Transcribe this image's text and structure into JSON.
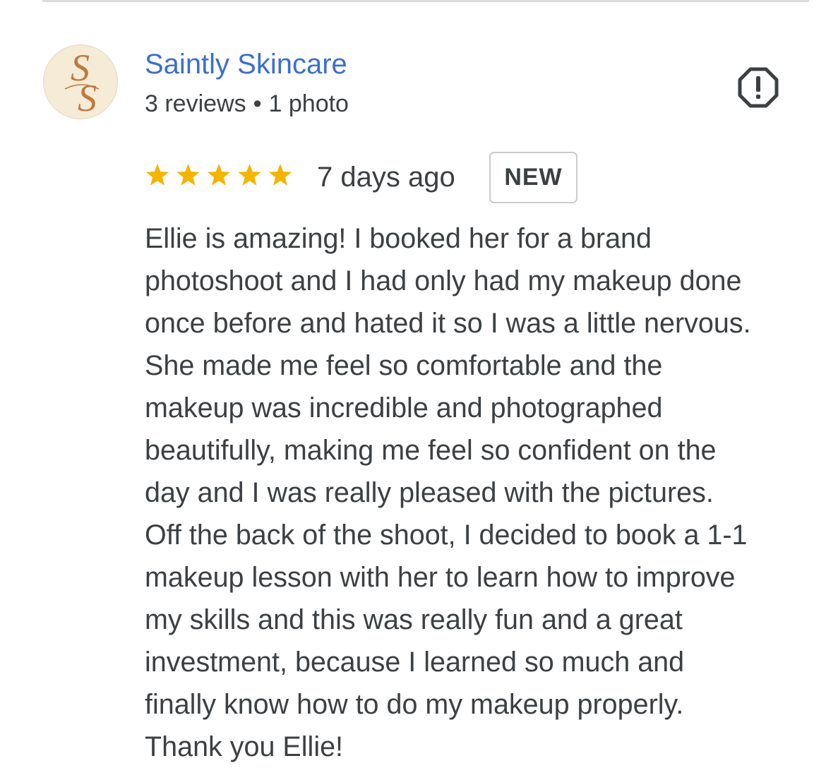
{
  "author": {
    "name": "Saintly Skincare",
    "avatar_monogram": "SS",
    "reviews_count": "3 reviews",
    "separator": "•",
    "photos_count": "1 photo"
  },
  "report_icon": "flag-alert-icon",
  "review": {
    "rating": 5,
    "rating_max": 5,
    "star_color": "#f4b400",
    "date": "7 days ago",
    "badge": "NEW",
    "text_lines": [
      "Ellie is amazing! I booked her for a brand",
      "photoshoot and I had only had my makeup done",
      "once before and hated it so I was a little nervous.",
      "She made me feel so comfortable and the",
      "makeup was incredible and photographed",
      "beautifully, making me feel so confident on the",
      "day and I was really pleased with the pictures.",
      "Off the back of the shoot, I decided to book a 1-1",
      "makeup lesson with her to learn how to improve",
      "my skills and this was really fun and a great",
      "investment, because I learned so much and",
      "finally know how to do my makeup properly.",
      "Thank you Ellie!"
    ]
  },
  "colors": {
    "author_link": "#3a6fcf",
    "text": "#3c4043",
    "avatar_bg": "#f5ebd6",
    "monogram": "#c0793e"
  }
}
